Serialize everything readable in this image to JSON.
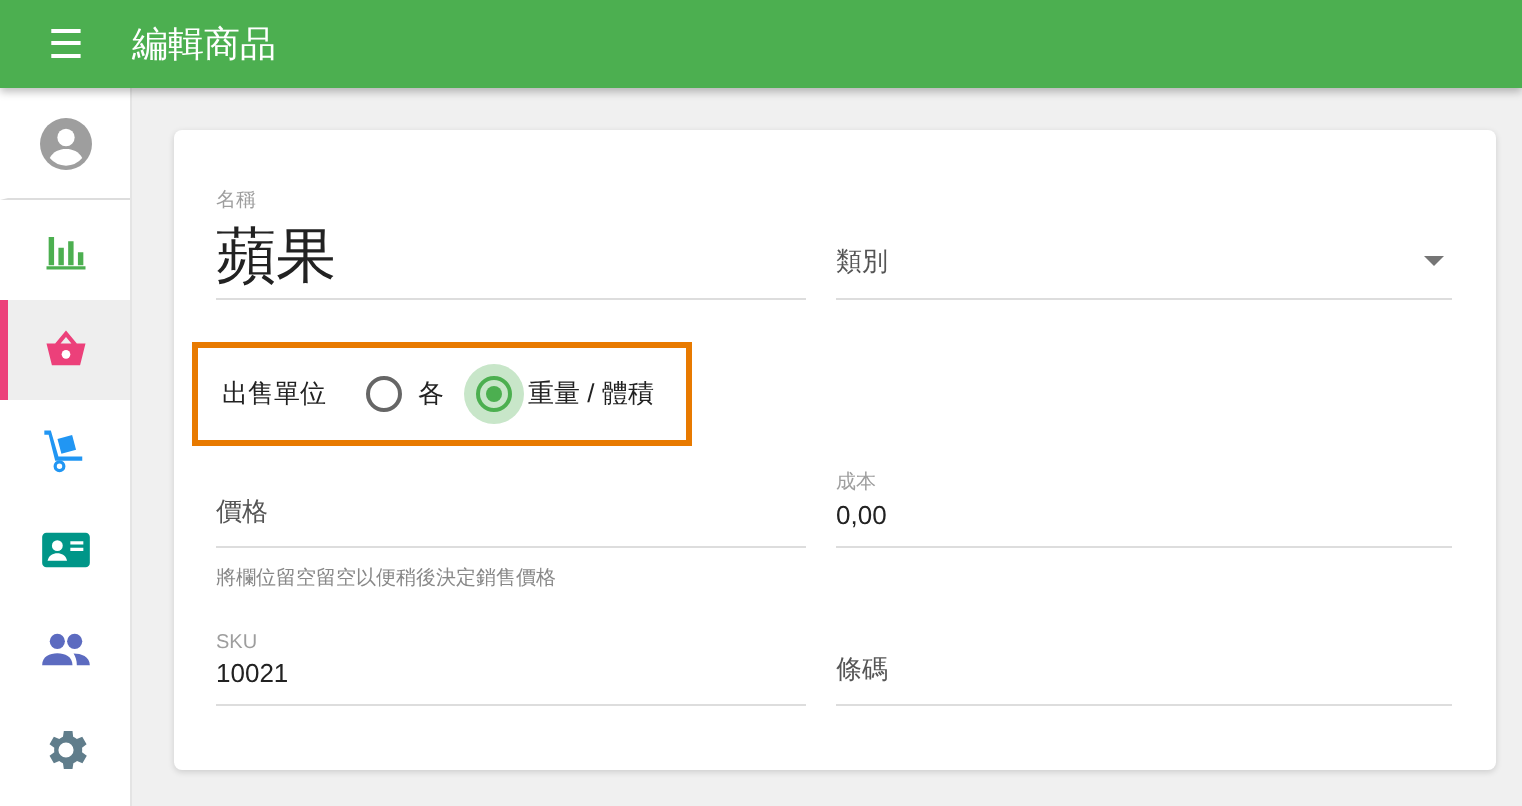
{
  "app_bar": {
    "menu_icon": "☰",
    "title": "編輯商品"
  },
  "sidebar": {
    "items": [
      {
        "kind": "avatar",
        "selected": false
      },
      {
        "kind": "chart",
        "selected": false
      },
      {
        "kind": "basket",
        "selected": true
      },
      {
        "kind": "cart",
        "selected": false
      },
      {
        "kind": "contact",
        "selected": false
      },
      {
        "kind": "people",
        "selected": false
      },
      {
        "kind": "settings",
        "selected": false
      }
    ]
  },
  "form": {
    "name": {
      "label": "名稱",
      "value": "蘋果"
    },
    "category": {
      "placeholder": "類別"
    },
    "sale_unit": {
      "label": "出售單位",
      "highlighted": true,
      "options": [
        {
          "label": "各",
          "selected": false
        },
        {
          "label": "重量 / 體積",
          "selected": true
        }
      ]
    },
    "price": {
      "placeholder": "價格",
      "hint": "將欄位留空留空以便稍後決定銷售價格"
    },
    "cost": {
      "label": "成本",
      "value": "0,00"
    },
    "sku": {
      "label": "SKU",
      "value": "10021"
    },
    "barcode": {
      "placeholder": "條碼"
    }
  }
}
